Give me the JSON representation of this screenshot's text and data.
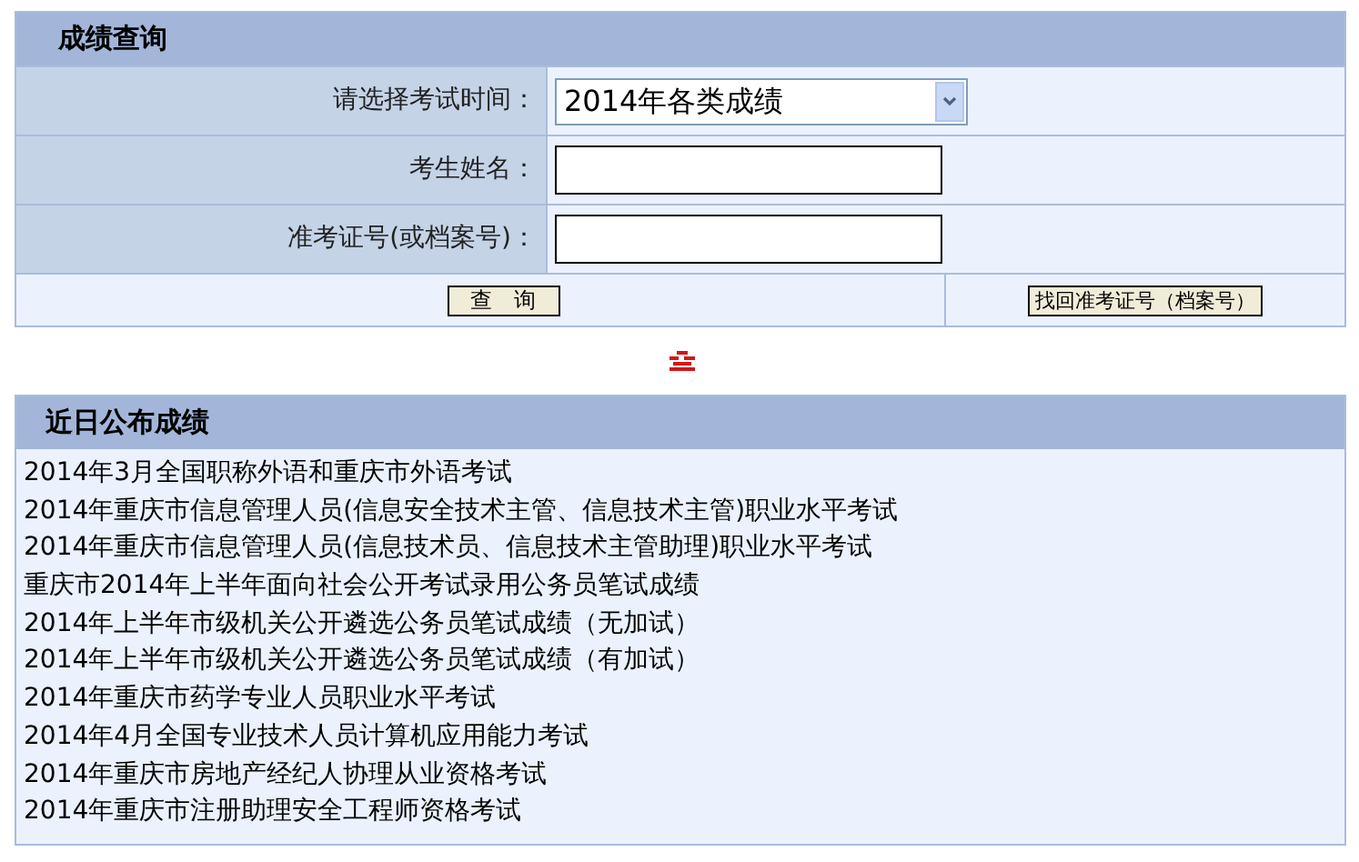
{
  "query_panel": {
    "title": "成绩查询",
    "fields": [
      {
        "kind": "select",
        "label": "请选择考试时间：",
        "value": "2014年各类成绩"
      },
      {
        "kind": "text",
        "label": "考生姓名："
      },
      {
        "kind": "text",
        "label": "准考证号(或档案号)："
      }
    ],
    "buttons": [
      "查　询",
      "找回准考证号（档案号）"
    ]
  },
  "recent_panel": {
    "title": "近日公布成绩",
    "items": [
      "2014年3月全国职称外语和重庆市外语考试",
      "2014年重庆市信息管理人员(信息安全技术主管、信息技术主管)职业水平考试",
      "2014年重庆市信息管理人员(信息技术员、信息技术主管助理)职业水平考试",
      "重庆市2014年上半年面向社会公开考试录用公务员笔试成绩",
      "2014年上半年市级机关公开遴选公务员笔试成绩（无加试）",
      "2014年上半年市级机关公开遴选公务员笔试成绩（有加试）",
      "2014年重庆市药学专业人员职业水平考试",
      "2014年4月全国专业技术人员计算机应用能力考试",
      "2014年重庆市房地产经纪人协理从业资格考试",
      "2014年重庆市注册助理安全工程师资格考试"
    ]
  }
}
